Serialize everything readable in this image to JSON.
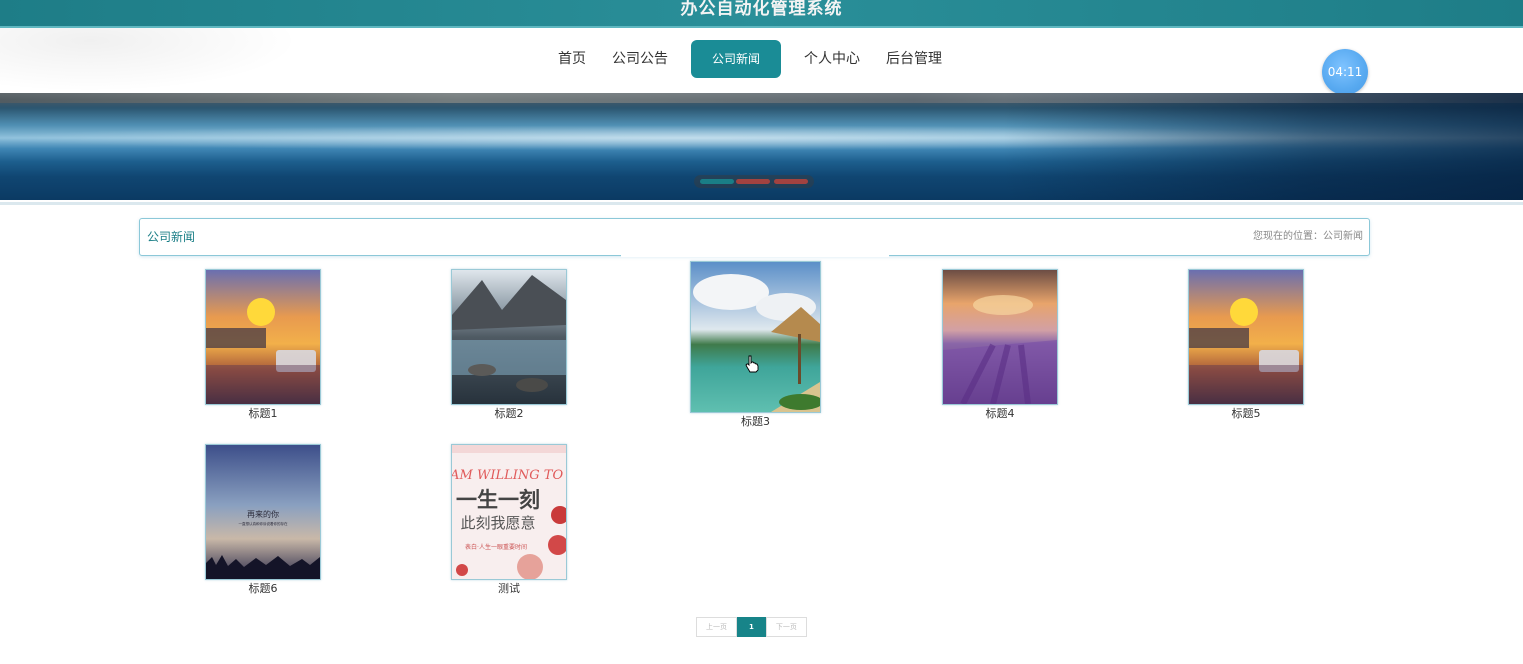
{
  "app": {
    "title": "办公自动化管理系统"
  },
  "nav": {
    "items": [
      {
        "label": "首页",
        "active": false
      },
      {
        "label": "公司公告",
        "active": false
      },
      {
        "label": "公司新闻",
        "active": true
      },
      {
        "label": "个人中心",
        "active": false
      },
      {
        "label": "后台管理",
        "active": false
      }
    ],
    "clock": "04:11"
  },
  "banner": {
    "slides": 3,
    "active_slide": 1
  },
  "section": {
    "title": "公司新闻",
    "breadcrumb": "您现在的位置：公司新闻"
  },
  "news": [
    {
      "caption": "标题1",
      "image": "sunset-river-boat"
    },
    {
      "caption": "标题2",
      "image": "mountain-river-stones"
    },
    {
      "caption": "标题3",
      "image": "beach-straw-umbrella"
    },
    {
      "caption": "标题4",
      "image": "lavender-field-sunset"
    },
    {
      "caption": "标题5",
      "image": "sunset-river-boat"
    },
    {
      "caption": "标题6",
      "image": "twilight-grass-sky"
    },
    {
      "caption": "测试",
      "image": "wedding-poster",
      "poster": {
        "line1": "I AM WILLING TO",
        "line2": "一生一刻",
        "line3": "此刻我愿意",
        "line4": "表白·人生一眼重要时间"
      }
    },
    {
      "poster_sky_text": {
        "line1": "再来的你",
        "line2": "一直想认真和你诉说着你的存在"
      }
    }
  ],
  "pagination": {
    "prev": "上一页",
    "current": "1",
    "next": "下一页"
  },
  "colors": {
    "accent": "#1a8c96",
    "topbar": "#1e7d87",
    "clock": "#57a9f0"
  }
}
